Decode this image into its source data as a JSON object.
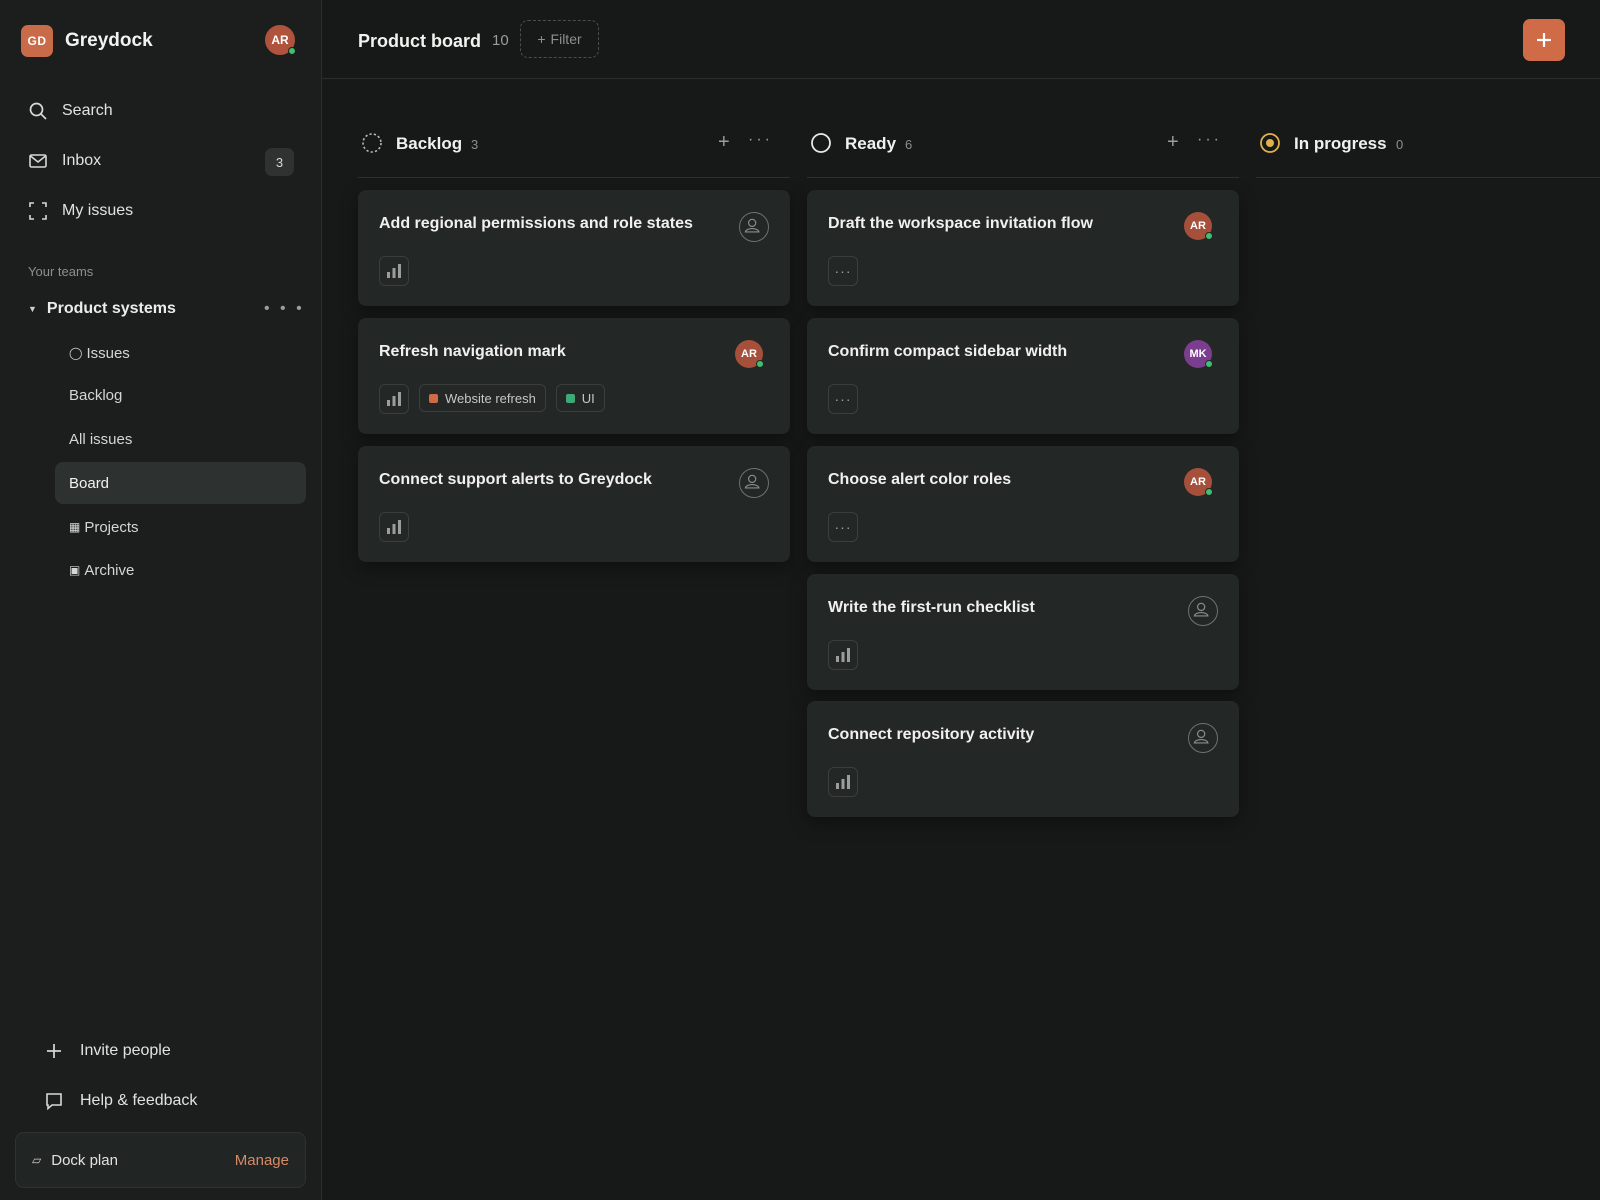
{
  "sidebar": {
    "workspace_logo": "GD",
    "workspace_name": "Greydock",
    "user_avatar": "AR",
    "nav": {
      "search": "Search",
      "inbox": "Inbox",
      "inbox_count": "3",
      "my_issues": "My issues"
    },
    "teams_label": "Your teams",
    "team": {
      "name": "Product systems",
      "more": "• • •",
      "items": {
        "issues": "Issues",
        "backlog": "Backlog",
        "all_issues": "All issues",
        "board": "Board",
        "projects": "Projects",
        "archive": "Archive"
      }
    },
    "invite": "Invite people",
    "help": "Help & feedback",
    "plan": {
      "name": "Dock plan",
      "action": "Manage"
    }
  },
  "header": {
    "title": "Product board",
    "count": "10",
    "filter": "Filter"
  },
  "columns": {
    "backlog": {
      "title": "Backlog",
      "count": "3",
      "cards": [
        {
          "title": "Add regional permissions and role states"
        },
        {
          "title": "Refresh navigation mark",
          "assignee": "AR",
          "labels": [
            "Website refresh",
            "UI"
          ]
        },
        {
          "title": "Connect support alerts to Greydock"
        }
      ]
    },
    "ready": {
      "title": "Ready",
      "count": "6",
      "cards": [
        {
          "title": "Draft the workspace invitation flow",
          "assignee": "AR"
        },
        {
          "title": "Confirm compact sidebar width",
          "assignee": "MK"
        },
        {
          "title": "Choose alert color roles",
          "assignee": "AR"
        },
        {
          "title": "Write the first-run checklist"
        },
        {
          "title": "Connect repository activity"
        }
      ]
    },
    "in_progress": {
      "title": "In progress",
      "count": "0"
    }
  },
  "colors": {
    "accent": "#d06b48",
    "label_website_refresh": "#d06b48",
    "label_ui": "#3fa877",
    "status_in_progress": "#e0b04a"
  }
}
